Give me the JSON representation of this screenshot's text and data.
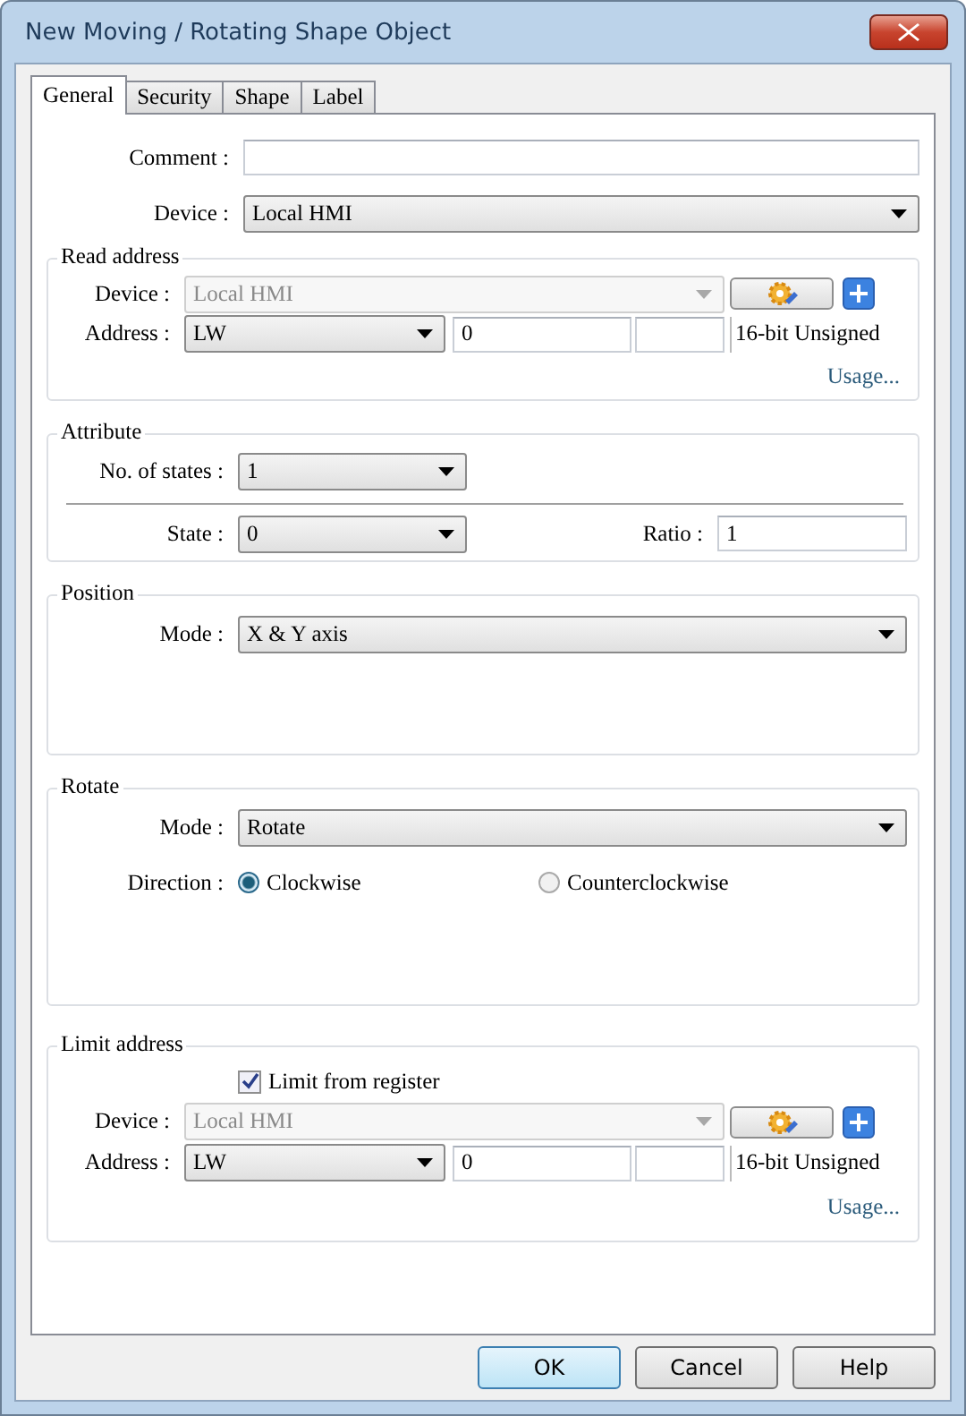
{
  "window": {
    "title": "New Moving / Rotating Shape Object"
  },
  "tabs": [
    {
      "label": "General",
      "selected": true
    },
    {
      "label": "Security",
      "selected": false
    },
    {
      "label": "Shape",
      "selected": false
    },
    {
      "label": "Label",
      "selected": false
    }
  ],
  "comment": {
    "label": "Comment :"
  },
  "device": {
    "label": "Device :",
    "value": "Local HMI"
  },
  "read_address": {
    "title": "Read address",
    "device_label": "Device :",
    "device_value": "Local HMI",
    "device_disabled": true,
    "address_label": "Address :",
    "address_type": "LW",
    "address_value": "0",
    "data_format": "16-bit Unsigned",
    "usage_link": "Usage..."
  },
  "attribute": {
    "title": "Attribute",
    "states_label": "No. of states :",
    "states_value": "1",
    "state_label": "State :",
    "state_value": "0",
    "ratio_label": "Ratio :",
    "ratio_value": "1"
  },
  "position": {
    "title": "Position",
    "mode_label": "Mode :",
    "mode_value": "X & Y axis"
  },
  "rotate": {
    "title": "Rotate",
    "mode_label": "Mode :",
    "mode_value": "Rotate",
    "direction_label": "Direction :",
    "directions": [
      {
        "label": "Clockwise",
        "selected": true
      },
      {
        "label": "Counterclockwise",
        "selected": false
      }
    ]
  },
  "limit_address": {
    "title": "Limit address",
    "checkbox_label": "Limit from register",
    "checked": true,
    "device_label": "Device :",
    "device_value": "Local HMI",
    "device_disabled": true,
    "address_label": "Address :",
    "address_type": "LW",
    "address_value": "0",
    "data_format": "16-bit Unsigned",
    "usage_link": "Usage..."
  },
  "buttons": [
    {
      "label": "OK",
      "default": true
    },
    {
      "label": "Cancel",
      "default": false
    },
    {
      "label": "Help",
      "default": false
    }
  ]
}
